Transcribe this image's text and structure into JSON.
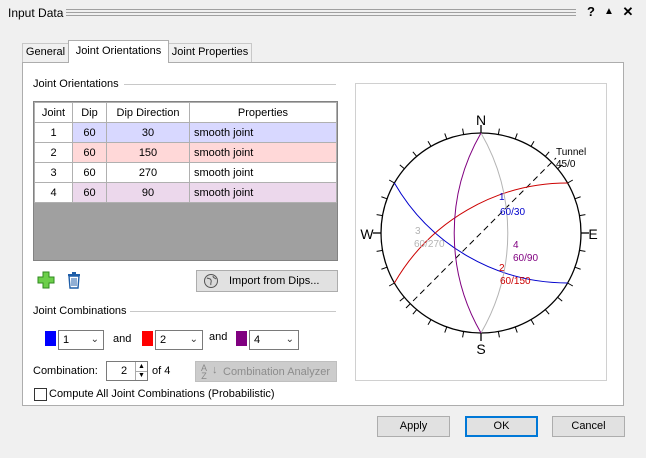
{
  "window": {
    "title": "Input Data",
    "help": "?",
    "collapse": "▲",
    "close": "✕"
  },
  "tabs": [
    {
      "label": "General"
    },
    {
      "label": "Joint Orientations"
    },
    {
      "label": "Joint Properties"
    }
  ],
  "joint_orientations": {
    "group_label": "Joint Orientations",
    "headers": [
      "Joint",
      "Dip",
      "Dip Direction",
      "Properties"
    ],
    "rows": [
      {
        "joint": "1",
        "dip": "60",
        "dip_direction": "30",
        "properties": "smooth joint",
        "color": "#d8d8ff"
      },
      {
        "joint": "2",
        "dip": "60",
        "dip_direction": "150",
        "properties": "smooth joint",
        "color": "#ffd8d8"
      },
      {
        "joint": "3",
        "dip": "60",
        "dip_direction": "270",
        "properties": "smooth joint",
        "color": "#ffffff"
      },
      {
        "joint": "4",
        "dip": "60",
        "dip_direction": "90",
        "properties": "smooth joint",
        "color": "#ecd8ec"
      }
    ],
    "import_button": "Import from Dips..."
  },
  "joint_combinations": {
    "group_label": "Joint Combinations",
    "combo1": {
      "value": "1",
      "color": "#0000ff"
    },
    "and1": "and",
    "combo2": {
      "value": "2",
      "color": "#ff0000"
    },
    "and2": "and",
    "combo3": {
      "value": "4",
      "color": "#800080"
    },
    "combination_label": "Combination:",
    "combination_value": "2",
    "combination_of": "of 4",
    "analyzer_button": "Combination Analyzer",
    "compute_all_label": "Compute All Joint Combinations (Probabilistic)"
  },
  "stereonet": {
    "north": "N",
    "south": "S",
    "east": "E",
    "west": "W",
    "tunnel_label": "Tunnel",
    "tunnel_value": "45/0",
    "joint1_label": "1",
    "joint1_value": "60/30",
    "joint2_label": "2",
    "joint2_value": "60/150",
    "joint3_label": "3",
    "joint3_value": "60/270",
    "joint4_label": "4",
    "joint4_value": "60/90",
    "colors": {
      "joint1": "#0000cc",
      "joint2": "#cc0000",
      "joint3": "#b4b4b4",
      "joint4": "#800080"
    }
  },
  "footer": {
    "apply": "Apply",
    "ok": "OK",
    "cancel": "Cancel"
  }
}
